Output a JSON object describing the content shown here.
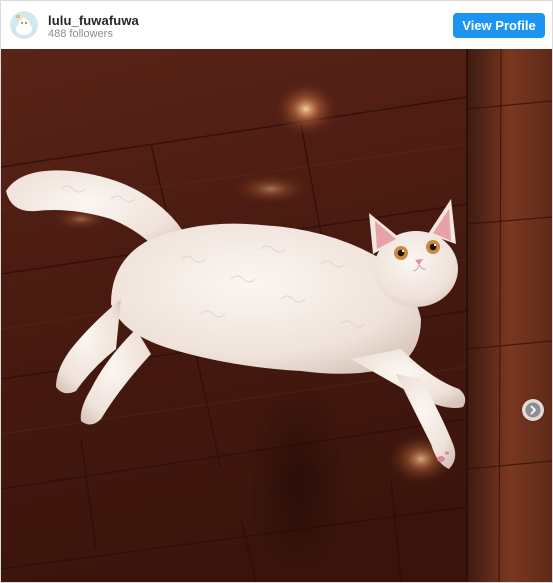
{
  "post": {
    "username": "lulu_fuwafuwa",
    "followers": "488 followers",
    "view_profile_label": "View Profile"
  },
  "icons": {
    "avatar": "profile-avatar",
    "next": "chevron-right-icon"
  },
  "colors": {
    "button": "#1c95f0",
    "floor": "#4a1c12",
    "cat": "#f4ece6"
  }
}
